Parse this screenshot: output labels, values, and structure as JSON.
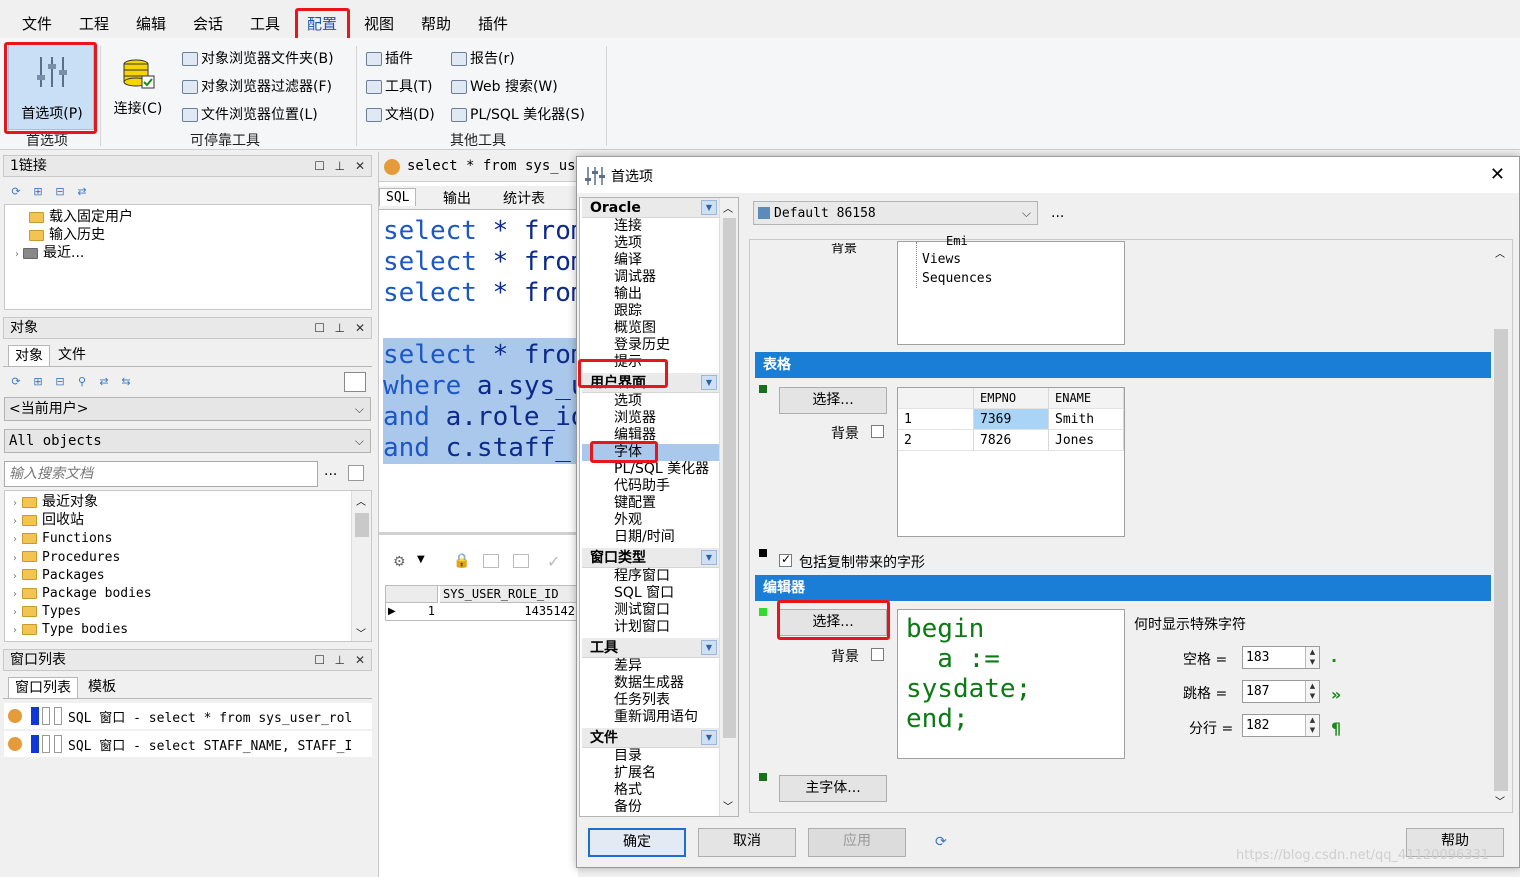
{
  "menubar": {
    "title_fragment": "...",
    "items": [
      "文件",
      "工程",
      "编辑",
      "会话",
      "工具",
      "配置",
      "视图",
      "帮助",
      "插件"
    ]
  },
  "ribbon": {
    "preferences_label": "首选项(P)",
    "connect_label": "连接(C)",
    "group_prefs": "首选项",
    "group_dock": "可停靠工具",
    "group_other": "其他工具",
    "dock_tools": [
      "对象浏览器文件夹(B)",
      "对象浏览器过滤器(F)",
      "文件浏览器位置(L)"
    ],
    "other_tools_col1": [
      "插件",
      "工具(T)",
      "文档(D)"
    ],
    "other_tools_col2": [
      "报告(r)",
      "Web 搜索(W)",
      "PL/SQL 美化器(S)"
    ]
  },
  "connections": {
    "title": "1链接",
    "items": [
      "载入固定用户",
      "输入历史",
      "最近..."
    ]
  },
  "objects": {
    "title": "对象",
    "tabs": [
      "对象",
      "文件"
    ],
    "user_combo": "<当前用户>",
    "filter_combo": "All objects",
    "search_placeholder": "输入搜索文档",
    "more": "...",
    "items": [
      "最近对象",
      "回收站",
      "Functions",
      "Procedures",
      "Packages",
      "Package bodies",
      "Types",
      "Type bodies"
    ]
  },
  "windows": {
    "title": "窗口列表",
    "tabs": [
      "窗口列表",
      "模板"
    ],
    "items": [
      "SQL 窗口 - select * from sys_user_rol",
      "SQL 窗口 - select STAFF_NAME, STAFF_I"
    ]
  },
  "sql_window": {
    "tab_title": "select * from sys_use",
    "tabs": [
      "SQL",
      "输出",
      "统计表"
    ],
    "lines": [
      {
        "kw": "select",
        "rest": " * from"
      },
      {
        "kw": "select",
        "rest": " * from"
      },
      {
        "kw": "select",
        "rest": " * from"
      },
      {
        "kw": "select",
        "rest": " * from"
      },
      {
        "kw": "where",
        "rest": " a.sys_u"
      },
      {
        "kw": "and",
        "rest": " a.role_id"
      },
      {
        "kw": "and",
        "rest": " c.staff_"
      }
    ],
    "result_header": "SYS_USER_ROLE_ID",
    "result_row_num": "1",
    "result_value": "1435142"
  },
  "dialog": {
    "title": "首选项",
    "close": "✕",
    "categories": [
      {
        "name": "Oracle",
        "items": [
          "连接",
          "选项",
          "编译",
          "调试器",
          "输出",
          "跟踪",
          "概览图",
          "登录历史",
          "提示"
        ]
      },
      {
        "name": "用户界面",
        "items": [
          "选项",
          "浏览器",
          "编辑器",
          "字体",
          "PL/SQL 美化器",
          "代码助手",
          "键配置",
          "外观",
          "日期/时间"
        ]
      },
      {
        "name": "窗口类型",
        "items": [
          "程序窗口",
          "SQL 窗口",
          "测试窗口",
          "计划窗口"
        ]
      },
      {
        "name": "工具",
        "items": [
          "差异",
          "数据生成器",
          "任务列表",
          "重新调用语句"
        ]
      },
      {
        "name": "文件",
        "items": [
          "目录",
          "扩展名",
          "格式",
          "备份"
        ]
      }
    ],
    "profile": "Default 86158",
    "profile_more": "...",
    "top_snippet": [
      "背景",
      "Emi",
      "Views",
      "Sequences"
    ],
    "grid_section": "表格",
    "choose": "选择...",
    "background": "背景",
    "grid_headers": [
      "EMPNO",
      "ENAME"
    ],
    "grid_rows": [
      [
        "1",
        "7369",
        "Smith"
      ],
      [
        "2",
        "7826",
        "Jones"
      ]
    ],
    "include_copy": "包括复制带来的字形",
    "editor_section": "编辑器",
    "editor_code": [
      "begin",
      "  a :=",
      "sysdate;",
      "end;"
    ],
    "special_chars": "何时显示特殊字符",
    "space_label": "空格 =",
    "tab_label": "跳格 =",
    "line_label": "分行 =",
    "space_val": "183",
    "tab_val": "187",
    "line_val": "182",
    "main_font": "主字体...",
    "ok": "确定",
    "cancel": "取消",
    "apply": "应用",
    "help": "帮助"
  },
  "watermark": "https://blog.csdn.net/qq_41120096331",
  "colors": {
    "accent": "#1a7ed6",
    "highlight": "#e8161a",
    "selection": "#aac8ec"
  }
}
